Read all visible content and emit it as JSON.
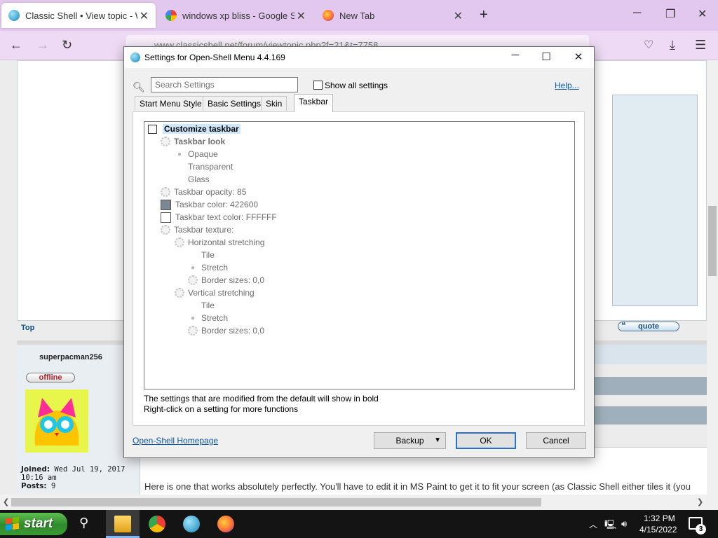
{
  "browser": {
    "tabs": [
      {
        "title": "Classic Shell • View topic - Wind",
        "active": true
      },
      {
        "title": "windows xp bliss - Google Sear",
        "active": false
      },
      {
        "title": "New Tab",
        "active": false
      }
    ],
    "url": "www.classicshell.net/forum/viewtopic.php?f=21&t=7758"
  },
  "webpage": {
    "top_link": "Top",
    "quote_label": "quote",
    "username": "superpacman256",
    "status": "offline",
    "joined_label": "Joined:",
    "joined_value": " Wed Jul 19, 2017",
    "joined_time": "10:16 am",
    "posts_label": "Posts:",
    "posts_value": " 9",
    "post_text": "Here is one that works absolutely perfectly. You'll have to edit it in MS Paint to get it to fit your screen (as Classic Shell either tiles it (you"
  },
  "dialog": {
    "title": "Settings for Open-Shell Menu 4.4.169",
    "search_placeholder": "Search Settings",
    "show_all_label": "Show all settings",
    "help_label": "Help...",
    "tabs": [
      "Start Menu Style",
      "Basic Settings",
      "Skin",
      "Taskbar"
    ],
    "active_tab": "Taskbar",
    "tree": [
      {
        "label": "Customize taskbar",
        "level": 0
      },
      {
        "label": "Taskbar look",
        "level": 1
      },
      {
        "label": "Opaque",
        "level": 2
      },
      {
        "label": "Transparent",
        "level": 2
      },
      {
        "label": "Glass",
        "level": 2
      },
      {
        "label": "Taskbar opacity: 85",
        "level": 1
      },
      {
        "label": "Taskbar color: 422600",
        "level": 1
      },
      {
        "label": "Taskbar text color: FFFFFF",
        "level": 1
      },
      {
        "label": "Taskbar texture:",
        "level": 1
      },
      {
        "label": "Horizontal stretching",
        "level": 2
      },
      {
        "label": "Tile",
        "level": 3
      },
      {
        "label": "Stretch",
        "level": 3
      },
      {
        "label": "Border sizes: 0,0",
        "level": 3
      },
      {
        "label": "Vertical stretching",
        "level": 2
      },
      {
        "label": "Tile",
        "level": 3
      },
      {
        "label": "Stretch",
        "level": 3
      },
      {
        "label": "Border sizes: 0,0",
        "level": 3
      }
    ],
    "note_line1": "The settings that are modified from the default will show in bold",
    "note_line2": "Right-click on a setting for more functions",
    "homepage_link": "Open-Shell Homepage",
    "backup_label": "Backup",
    "ok_label": "OK",
    "cancel_label": "Cancel",
    "swatch_colors": {
      "taskbar_color": "#7b8794",
      "text_color": "#ffffff"
    }
  },
  "taskbar": {
    "start_label": "start",
    "time": "1:32 PM",
    "date": "4/15/2022",
    "notification_count": "3"
  },
  "colors": {
    "tab_strip": "#e2c8ee",
    "taskbar": "#141414",
    "start_green": "#3c9a35",
    "link_blue": "#0b57a4"
  }
}
